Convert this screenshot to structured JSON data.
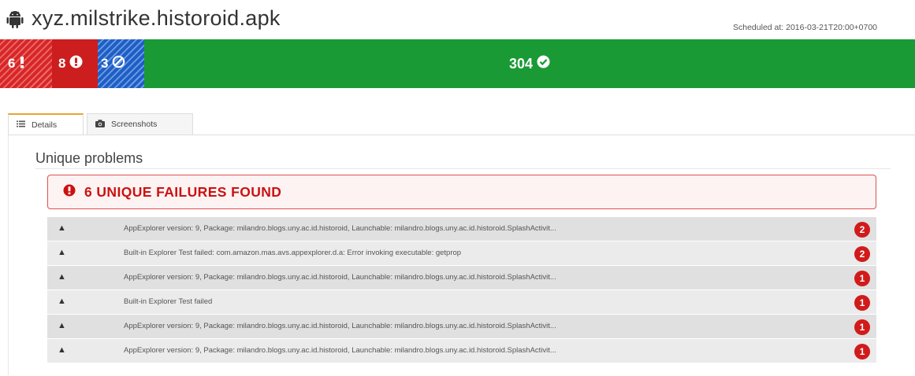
{
  "header": {
    "app_title": "xyz.milstrike.historoid.apk",
    "scheduled_text": "Scheduled at: 2016-03-21T20:00+0700",
    "icon": "android-icon"
  },
  "summary": {
    "warning_count": "6",
    "failed_count": "8",
    "skipped_count": "3",
    "passed_count": "304",
    "colors": {
      "warning": "#d62728",
      "failed": "#cc1e1e",
      "skipped": "#1f5fc4",
      "passed": "#1a9a35"
    },
    "icons": [
      "exclamation-icon",
      "alert-circle-icon",
      "ban-icon",
      "check-circle-icon"
    ]
  },
  "tabs": [
    {
      "label": "Details",
      "icon": "list-icon",
      "active": true
    },
    {
      "label": "Screenshots",
      "icon": "camera-icon",
      "active": false
    }
  ],
  "section": {
    "title": "Unique problems"
  },
  "alert": {
    "text": "6 UNIQUE FAILURES FOUND",
    "icon": "alert-circle-icon",
    "color": "#cc1111"
  },
  "problems": [
    {
      "text": "AppExplorer version: 9, Package: milandro.blogs.uny.ac.id.historoid, Launchable: milandro.blogs.uny.ac.id.historoid.SplashActivit...",
      "count": "2"
    },
    {
      "text": "Built-in Explorer Test failed: com.amazon.mas.avs.appexplorer.d.a: Error invoking executable: getprop",
      "count": "2"
    },
    {
      "text": "AppExplorer version: 9, Package: milandro.blogs.uny.ac.id.historoid, Launchable: milandro.blogs.uny.ac.id.historoid.SplashActivit...",
      "count": "1"
    },
    {
      "text": "Built-in Explorer Test failed",
      "count": "1"
    },
    {
      "text": "AppExplorer version: 9, Package: milandro.blogs.uny.ac.id.historoid, Launchable: milandro.blogs.uny.ac.id.historoid.SplashActivit...",
      "count": "1"
    },
    {
      "text": "AppExplorer version: 9, Package: milandro.blogs.uny.ac.id.historoid, Launchable: milandro.blogs.uny.ac.id.historoid.SplashActivit...",
      "count": "1"
    }
  ]
}
